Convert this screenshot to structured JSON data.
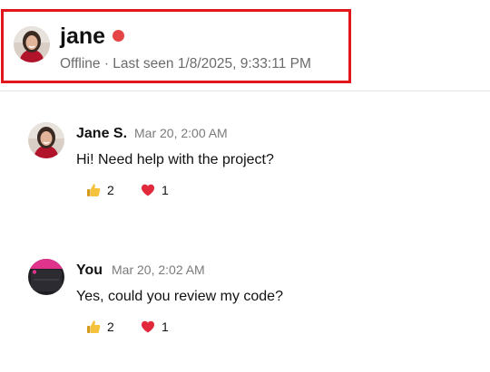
{
  "header": {
    "name": "jane",
    "status": "Offline · Last seen 1/8/2025, 9:33:11 PM",
    "status_dot_color": "#e64545",
    "highlight_color": "#e0161b"
  },
  "messages": [
    {
      "sender": "Jane S.",
      "time": "Mar 20, 2:00 AM",
      "text": "Hi! Need help with the project?",
      "avatar": "jane-photo",
      "reactions": [
        {
          "icon": "thumbs-up-icon",
          "count": "2"
        },
        {
          "icon": "heart-icon",
          "count": "1"
        }
      ]
    },
    {
      "sender": "You",
      "time": "Mar 20, 2:02 AM",
      "text": "Yes, could you review my code?",
      "avatar": "user-photo",
      "reactions": [
        {
          "icon": "thumbs-up-icon",
          "count": "2"
        },
        {
          "icon": "heart-icon",
          "count": "1"
        }
      ]
    }
  ]
}
